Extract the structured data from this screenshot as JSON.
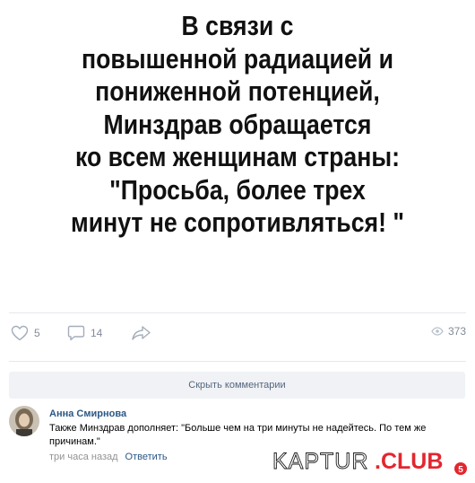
{
  "post": {
    "meme_lines": [
      "В связи с",
      "повышенной радиацией и",
      "пониженной потенцией,",
      "Минздрав обращается",
      "ко всем женщинам страны:",
      "\"Просьба, более трех",
      "минут не сопротивляться! \""
    ]
  },
  "actions": {
    "likes": "5",
    "comments": "14",
    "views": "373"
  },
  "hide_comments_label": "Скрыть комментарии",
  "comment": {
    "author": "Анна Смирнова",
    "text": "Также Минздрав дополняет: \"Больше чем на три минуты не надейтесь. По тем же причинам.\"",
    "time": "три часа назад",
    "reply_label": "Ответить"
  },
  "watermark": {
    "text_kaptur": "KAPTUR",
    "text_club": ".CLUB",
    "badge": "5"
  },
  "colors": {
    "link": "#2a5885",
    "muted": "#828a99",
    "button_bg": "#f0f2f5",
    "watermark_red": "#e3262f"
  }
}
